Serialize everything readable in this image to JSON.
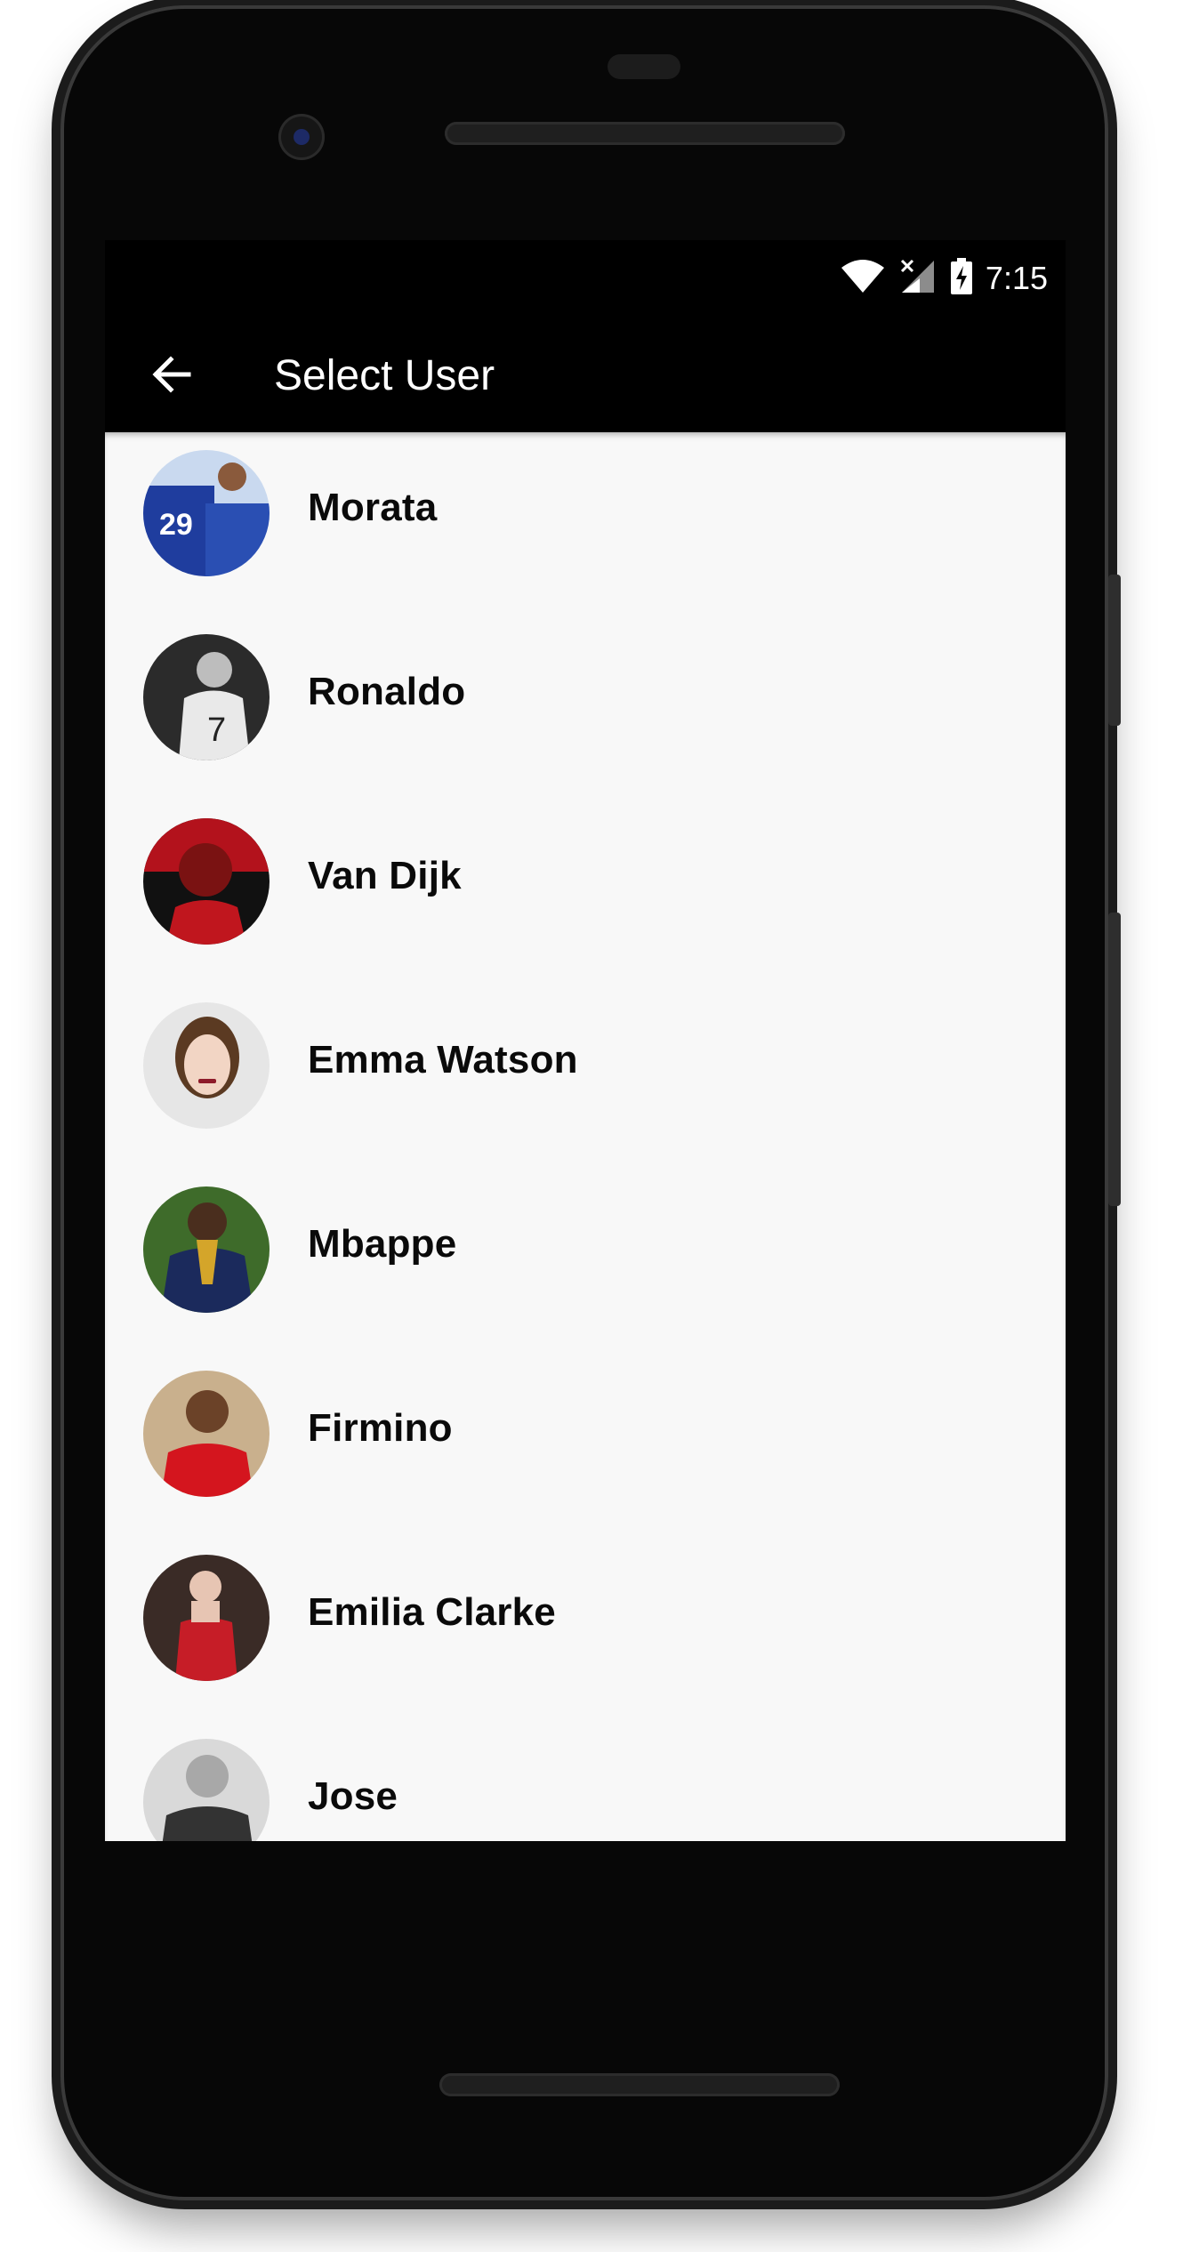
{
  "status_bar": {
    "time": "7:15",
    "icons": [
      "wifi-icon",
      "signal-icon",
      "battery-charging-icon"
    ]
  },
  "app_bar": {
    "title": "Select User",
    "back_icon": "arrow-back-icon"
  },
  "users": [
    {
      "name": "Morata"
    },
    {
      "name": "Ronaldo"
    },
    {
      "name": "Van Dijk"
    },
    {
      "name": "Emma Watson"
    },
    {
      "name": "Mbappe"
    },
    {
      "name": "Firmino"
    },
    {
      "name": "Emilia Clarke"
    },
    {
      "name": "Jose"
    }
  ],
  "nav_bar": {
    "buttons": [
      "back-triangle-icon",
      "home-circle-icon",
      "recents-square-icon"
    ]
  },
  "colors": {
    "list_background": "#f8f8f8",
    "bar_background": "#000000",
    "text_primary": "#0a0a0a"
  }
}
